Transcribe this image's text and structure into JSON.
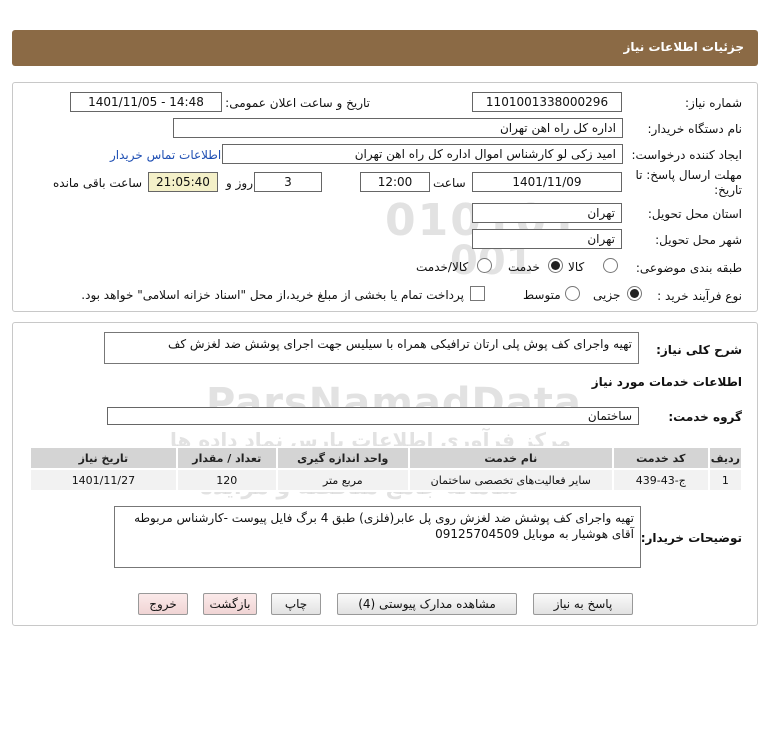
{
  "header": {
    "title": "جزئیات اطلاعات نیاز"
  },
  "form": {
    "need_number_label": "شماره نیاز:",
    "need_number": "1101001338000296",
    "announce_label": "تاریخ و ساعت اعلان عمومی:",
    "announce_value": "1401/11/05 - 14:48",
    "buyer_org_label": "نام دستگاه خریدار:",
    "buyer_org": "اداره کل راه اهن تهران",
    "creator_label": "ایجاد کننده درخواست:",
    "creator": "امید زکی لو کارشناس اموال اداره کل راه اهن تهران",
    "contact_link": "اطلاعات تماس خریدار",
    "deadline_label_1": "مهلت ارسال پاسخ: تا",
    "deadline_label_2": "تاریخ:",
    "deadline_date": "1401/11/09",
    "time_label": "ساعت",
    "deadline_time": "12:00",
    "days_value": "3",
    "days_label": "روز و",
    "remaining_time": "21:05:40",
    "remaining_label": "ساعت باقی مانده",
    "province_label": "استان محل تحویل:",
    "province": "تهران",
    "city_label": "شهر محل تحویل:",
    "city": "تهران",
    "category_label": "طبقه بندی موضوعی:",
    "category_options": [
      "کالا",
      "خدمت",
      "کالا/خدمت"
    ],
    "category_selected": "خدمت",
    "process_label": "نوع فرآیند خرید :",
    "process_options": [
      "جزیی",
      "متوسط"
    ],
    "process_selected": "جزیی",
    "payment_note": "پرداخت تمام یا بخشی از مبلغ خرید،از محل \"اسناد خزانه اسلامی\" خواهد بود."
  },
  "details": {
    "summary_label": "شرح کلی نیاز:",
    "summary": "تهیه واجرای کف پوش پلی ارتان ترافیکی همراه با سیلیس جهت اجرای پوشش ضد لغزش کف",
    "services_heading": "اطلاعات خدمات مورد نیاز",
    "service_group_label": "گروه خدمت:",
    "service_group": "ساختمان",
    "table": {
      "headers": [
        "ردیف",
        "کد خدمت",
        "نام خدمت",
        "واحد اندازه گیری",
        "تعداد / مقدار",
        "تاریخ نیاز"
      ],
      "rows": [
        [
          "1",
          "ج-43-439",
          "سایر فعالیت‌های تخصصی ساختمان",
          "مربع متر",
          "120",
          "1401/11/27"
        ]
      ]
    },
    "buyer_notes_label": "توضیحات خریدار:",
    "buyer_notes": "تهیه واجرای کف پوشش ضد لغزش روی پل عابر(فلزی) طبق 4 برگ فایل پیوست -کارشناس مربوطه آقای هوشیار به موبایل 09125704509"
  },
  "buttons": {
    "reply": "پاسخ به نیاز",
    "view_docs": "مشاهده مدارک پیوستی (4)",
    "print": "چاپ",
    "back": "بازگشت",
    "exit": "خروج"
  },
  "watermark": {
    "text_1": "ParsNamadData",
    "text_2": "مرکز فرآوری اطلاعات پارس نماد داده ها",
    "text_3": "سامانه جامع مناقصه و مزایده",
    "text_4": "۰۲۱-۸۸۳۴۹۶۷۰"
  }
}
